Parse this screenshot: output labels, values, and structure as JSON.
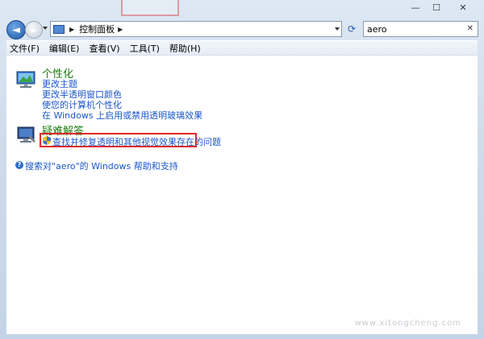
{
  "window": {
    "caption": {
      "minimize": "—",
      "maximize": "☐",
      "close": "✕"
    }
  },
  "nav": {
    "back_glyph": "◄",
    "forward_glyph": "►",
    "address": {
      "icon": "control-panel-icon",
      "path": "控制面板"
    },
    "search": {
      "value": "aero",
      "clear": "✕"
    }
  },
  "menubar": {
    "items": [
      "文件(F)",
      "编辑(E)",
      "查看(V)",
      "工具(T)",
      "帮助(H)"
    ]
  },
  "results": {
    "categories": [
      {
        "title": "个性化",
        "icon": "personalization-icon",
        "links": [
          "更改主题",
          "更改半透明窗口颜色",
          "使您的计算机个性化",
          "在 Windows 上启用或禁用透明玻璃效果"
        ]
      },
      {
        "title": "疑难解答",
        "icon": "troubleshooting-icon",
        "links": [
          "查找并修复透明和其他视觉效果存在的问题"
        ]
      }
    ],
    "help_link": "搜索对\"aero\"的 Windows 帮助和支持"
  },
  "watermark": "www.xitongcheng.com",
  "colors": {
    "title_green": "#1e7a12",
    "link_blue": "#1a56c8",
    "highlight_red": "#e02828"
  }
}
